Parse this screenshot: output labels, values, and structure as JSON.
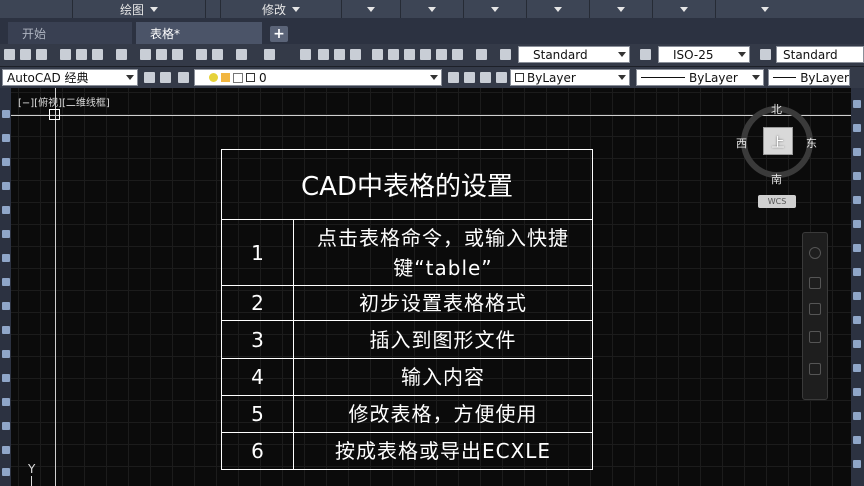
{
  "menubar": {
    "items": [
      {
        "label": "",
        "has_caret": false
      },
      {
        "label": "绘图",
        "has_caret": true
      },
      {
        "label": "",
        "has_caret": false
      },
      {
        "label": "修改",
        "has_caret": true
      },
      {
        "label": "",
        "has_caret": true
      },
      {
        "label": "",
        "has_caret": true
      },
      {
        "label": "",
        "has_caret": true
      },
      {
        "label": "",
        "has_caret": true
      },
      {
        "label": "",
        "has_caret": true
      },
      {
        "label": "",
        "has_caret": true
      },
      {
        "label": "",
        "has_caret": true
      }
    ]
  },
  "tabs": {
    "start_label": "开始",
    "active_label": "表格*",
    "add_label": "+"
  },
  "toolbar1": {
    "text_style": "Standard",
    "dim_style": "ISO-25",
    "table_style": "Standard"
  },
  "toolbar2": {
    "workspace": "AutoCAD 经典",
    "layer": "0",
    "color": "ByLayer",
    "linetype": "ByLayer",
    "lineweight": "ByLayer"
  },
  "viewport": {
    "label": "[−][俯视][二维线框]",
    "ucs_axis": "Y"
  },
  "viewcube": {
    "north": "北",
    "south": "南",
    "east": "东",
    "west": "西",
    "face": "上",
    "wcs": "WCS"
  },
  "table": {
    "title": "CAD中表格的设置",
    "rows": [
      {
        "num": "1",
        "text": "点击表格命令，或输入快捷\n键“table”"
      },
      {
        "num": "2",
        "text": "初步设置表格格式"
      },
      {
        "num": "3",
        "text": "插入到图形文件"
      },
      {
        "num": "4",
        "text": "输入内容"
      },
      {
        "num": "5",
        "text": "修改表格，方便使用"
      },
      {
        "num": "6",
        "text": "按成表格或导出ECXLE"
      }
    ]
  }
}
